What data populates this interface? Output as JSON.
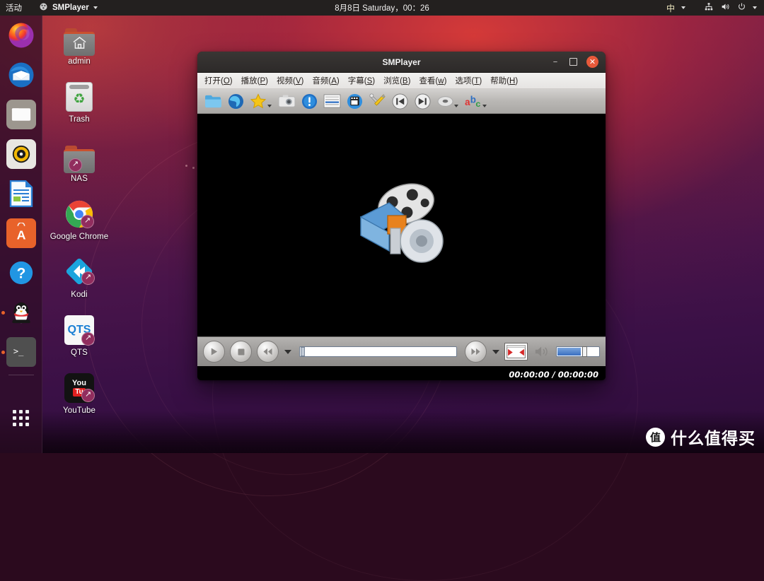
{
  "topbar": {
    "activities": "活动",
    "app_menu": {
      "name": "SMPlayer",
      "icon": "smplayer-icon",
      "caret": "chevron-down-icon"
    },
    "clock": "8月8日 Saturday，00：26",
    "tray": {
      "input_method": "中",
      "input_caret": "chevron-down-icon",
      "network_icon": "network-wired-icon",
      "volume_icon": "volume-icon",
      "power_icon": "power-icon",
      "menu_caret": "chevron-down-icon"
    }
  },
  "dock": {
    "items": [
      {
        "name": "Firefox",
        "icon": "firefox-icon",
        "running": false
      },
      {
        "name": "Thunderbird",
        "icon": "thunderbird-icon",
        "running": false
      },
      {
        "name": "Files",
        "icon": "files-icon",
        "running": false
      },
      {
        "name": "Rhythmbox",
        "icon": "rhythmbox-icon",
        "running": false
      },
      {
        "name": "LibreOffice Writer",
        "icon": "libreoffice-writer-icon",
        "running": false
      },
      {
        "name": "Ubuntu Software",
        "icon": "ubuntu-software-icon",
        "running": false
      },
      {
        "name": "Help",
        "icon": "help-icon",
        "running": false
      },
      {
        "name": "QQ",
        "icon": "qq-penguin-icon",
        "running": true
      },
      {
        "name": "Terminal",
        "icon": "terminal-icon",
        "running": true
      }
    ],
    "show_applications": {
      "name": "Show Applications",
      "icon": "grid-apps-icon"
    }
  },
  "desktop_icons": [
    {
      "label": "admin",
      "icon": "home-folder-icon",
      "shortcut": false
    },
    {
      "label": "Trash",
      "icon": "trash-icon",
      "shortcut": false
    },
    {
      "label": "NAS",
      "icon": "folder-icon",
      "shortcut": true
    },
    {
      "label": "Google Chrome",
      "icon": "chrome-icon",
      "shortcut": true
    },
    {
      "label": "Kodi",
      "icon": "kodi-icon",
      "shortcut": true
    },
    {
      "label": "QTS",
      "icon": "qts-icon",
      "shortcut": true
    },
    {
      "label": "YouTube",
      "icon": "youtube-icon",
      "shortcut": true
    }
  ],
  "smplayer": {
    "title": "SMPlayer",
    "window_buttons": {
      "minimize": "−",
      "maximize": "□",
      "close": "✕"
    },
    "menus": [
      {
        "label": "打开(O)",
        "text": "打开(",
        "key": "O",
        "tail": ")"
      },
      {
        "label": "播放(P)",
        "text": "播放(",
        "key": "P",
        "tail": ")"
      },
      {
        "label": "视频(V)",
        "text": "视频(",
        "key": "V",
        "tail": ")"
      },
      {
        "label": "音频(A)",
        "text": "音频(",
        "key": "A",
        "tail": ")"
      },
      {
        "label": "字幕(S)",
        "text": "字幕(",
        "key": "S",
        "tail": ")"
      },
      {
        "label": "浏览(B)",
        "text": "浏览(",
        "key": "B",
        "tail": ")"
      },
      {
        "label": "查看(w)",
        "text": "查看(",
        "key": "w",
        "tail": ")"
      },
      {
        "label": "选项(T)",
        "text": "选项(",
        "key": "T",
        "tail": ")"
      },
      {
        "label": "帮助(H)",
        "text": "帮助(",
        "key": "H",
        "tail": ")"
      }
    ],
    "toolbar": [
      {
        "name": "open-file-button",
        "icon": "folder-icon",
        "dropdown": false
      },
      {
        "name": "open-url-button",
        "icon": "globe-icon",
        "dropdown": false
      },
      {
        "name": "favorites-button",
        "icon": "star-icon",
        "dropdown": true
      },
      {
        "name": "screenshot-button",
        "icon": "camera-icon",
        "dropdown": false
      },
      {
        "name": "media-info-button",
        "icon": "info-icon",
        "dropdown": false
      },
      {
        "name": "playlist-button",
        "icon": "playlist-icon",
        "dropdown": false
      },
      {
        "name": "open-dvd-button",
        "icon": "dvd-icon",
        "dropdown": false
      },
      {
        "name": "preferences-button",
        "icon": "tools-icon",
        "dropdown": false
      },
      {
        "name": "previous-button",
        "icon": "skip-previous-icon",
        "dropdown": false
      },
      {
        "name": "next-button",
        "icon": "skip-next-icon",
        "dropdown": false
      },
      {
        "name": "audio-track-button",
        "icon": "audio-disc-icon",
        "dropdown": true
      },
      {
        "name": "subtitles-button",
        "icon": "abc-subtitle-icon",
        "dropdown": true
      }
    ],
    "video_logo": "smplayer-film-reel-logo",
    "controls": {
      "play": {
        "name": "play-button",
        "icon": "play-icon"
      },
      "stop": {
        "name": "stop-button",
        "icon": "stop-icon"
      },
      "rewind": {
        "name": "rewind-button",
        "icon": "rewind-icon",
        "dropdown": true
      },
      "seek": {
        "name": "seek-slider",
        "value": 0,
        "min": 0,
        "max": 100
      },
      "forward": {
        "name": "forward-button",
        "icon": "fast-forward-icon",
        "dropdown": true
      },
      "fullscreen": {
        "name": "fullscreen-button",
        "icon": "fullscreen-icon"
      },
      "mute": {
        "name": "mute-button",
        "icon": "speaker-icon"
      },
      "volume": {
        "name": "volume-slider",
        "value": 55,
        "min": 0,
        "max": 100
      }
    },
    "status": {
      "time": "00:00:00 / 00:00:00",
      "current": "00:00:00",
      "total": "00:00:00"
    }
  },
  "watermark": {
    "badge": "值",
    "text": "什么值得买"
  },
  "colors": {
    "accent_orange": "#e8622a",
    "close_button": "#e8593a",
    "topbar_bg": "#23201f",
    "menubar_bg": "#efedeb",
    "video_bg": "#000000",
    "wallpaper_top": "#8f2440",
    "wallpaper_bottom": "#2d0c3a"
  }
}
